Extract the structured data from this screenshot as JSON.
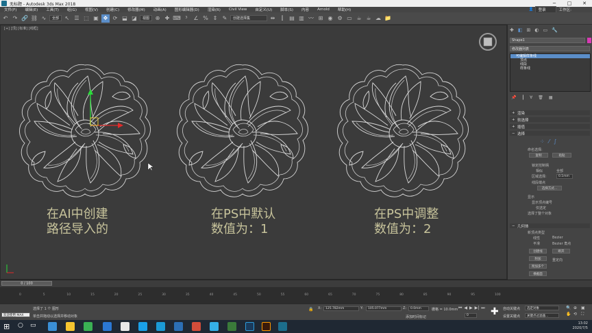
{
  "window": {
    "title": "无标题 - Autodesk 3ds Max 2018"
  },
  "menu": {
    "items": [
      "文件(F)",
      "编辑(E)",
      "工具(T)",
      "组(G)",
      "视图(V)",
      "创建(C)",
      "修改器(M)",
      "动画(A)",
      "图形编辑器(D)",
      "渲染(R)",
      "Civil View",
      "自定义(U)",
      "脚本(S)",
      "内容",
      "Arnold",
      "帮助(H)"
    ],
    "signin": "登录",
    "workspace": "工作区:"
  },
  "toolbar": {
    "filter_dropdown": "全部",
    "view_dropdown": "视图",
    "selection_set": "创建选择集"
  },
  "viewport": {
    "label": "[+] [顶] [标准] [线框]",
    "captions": [
      {
        "line1": "在AI中创建",
        "line2": "路径导入的"
      },
      {
        "line1": "在PS中默认",
        "line2": "数值为：1"
      },
      {
        "line1": "在PS中调整",
        "line2": "数值为：2"
      }
    ]
  },
  "command_panel": {
    "object_name": "Shape1",
    "modifier_list": "修改器列表",
    "stack_items": [
      "可编辑样条线",
      "顶点",
      "线段",
      "样条线"
    ],
    "rollouts": [
      "渲染",
      "软选择",
      "插值",
      "选择",
      "几何体"
    ],
    "selection": {
      "named_sel": "命名选择:",
      "copy": "复制",
      "paste": "粘贴",
      "lock_handles": "锁定控制柄",
      "similar": "相似",
      "all": "全部",
      "area_sel": "区域选择:",
      "area_value": "0.1mm",
      "segment_end": "线段端点",
      "select_by": "选择方式...",
      "display": "显示",
      "show_vertex_numbers": "显示顶点编号",
      "selected_only": "仅选定",
      "status": "选择了整个对象"
    },
    "geometry": {
      "new_vertex_type": "新顶点类型",
      "linear": "线性",
      "bezier": "Bezier",
      "smooth": "平滑",
      "bezier_corner": "Bezier 角点",
      "create_line": "创建线",
      "break": "断开",
      "attach": "附加",
      "attach_multiple": "附加多个",
      "reorient": "重定向",
      "cross_section": "横截面"
    }
  },
  "timeline": {
    "frame_display": "0 / 100",
    "ticks": [
      "0",
      "5",
      "10",
      "15",
      "20",
      "25",
      "30",
      "35",
      "40",
      "45",
      "50",
      "55",
      "60",
      "65",
      "70",
      "75",
      "80",
      "85",
      "90",
      "95",
      "100"
    ]
  },
  "status": {
    "welcome": "欢迎使用 MAX",
    "selected": "选择了 1 个 图形",
    "hint": "单击并拖动以选择并移动对象",
    "x_label": "X:",
    "x_value": "125.782mm",
    "y_label": "Y:",
    "y_value": "105.077mm",
    "z_label": "Z:",
    "z_value": "0.0mm",
    "grid": "栅格 = 10.0mm",
    "add_time_tag": "添加时间标记",
    "auto_key": "自动关键点",
    "set_key": "设置关键点",
    "selected_obj": "选定对象",
    "key_filters": "关键点过滤器...",
    "frame": "0"
  },
  "taskbar": {
    "time": "13:02",
    "date": "2020/7/5"
  }
}
